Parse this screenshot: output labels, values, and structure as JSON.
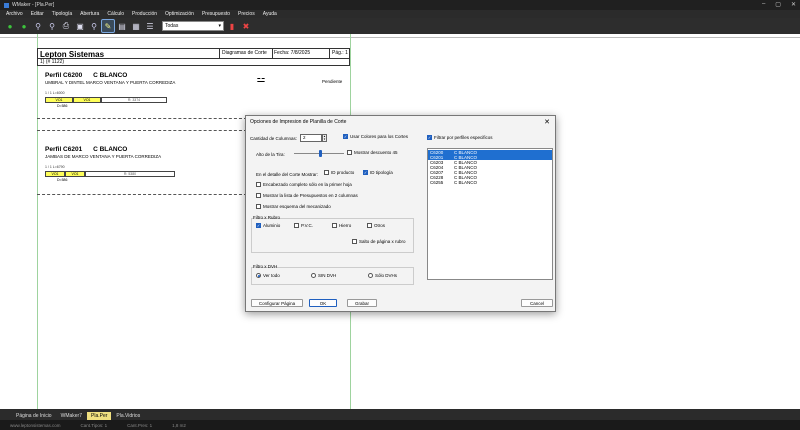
{
  "window": {
    "title": "WMaker - [Pla.Per]"
  },
  "menu": [
    "Archivo",
    "Editar",
    "Tipología",
    "Abertura",
    "Cálculo",
    "Producción",
    "Optimización",
    "Presupuesto",
    "Precios",
    "Ayuda"
  ],
  "toolbar": {
    "combo_value": "Todas"
  },
  "report": {
    "company": "Lepton Sistemas",
    "title": "Diagramas de Corte",
    "fecha": "Fecha: 7/8/2025",
    "pag": "Pág.: 1",
    "row2": "1)   (# 1122)",
    "profiles": [
      {
        "code": "Perfil C6200",
        "color": "C BLANCO",
        "desc": "UMBRAL Y DINTEL MARCO VENTANA Y PUERTA CORREDIZA",
        "status": "Pendiente",
        "small": "1 / 1   L=6000",
        "bars": [
          "VO1",
          "VO1",
          "R: 3374"
        ],
        "dim": "D=586"
      },
      {
        "code": "Perfil C6201",
        "color": "C BLANCO",
        "desc": "JAMBAS DE MARCO VENTANA Y PUERTA CORREDIZA",
        "small": "1 / 1   L=6790",
        "bars": [
          "VO1",
          "VO1",
          "R: 5380"
        ],
        "dim": "D=586"
      }
    ]
  },
  "dialog": {
    "title": "Opciones de Impresion de Planilla de Corte",
    "columnas_label": "Cantidad de Columnas:",
    "columnas_value": "2",
    "usar_colores": "Usar Colores para los Cortes",
    "alto_tira": "Alto de la Tira:",
    "mostrar_descuento": "Mostrar descuento 45",
    "detalle_label": "En el detalle del Corte Mostrar:",
    "id_producto": "ID producto",
    "id_tipologia": "ID tipología",
    "encabezado": "Encabezado completo sólo en la primer hoja",
    "mostrar_lista": "Mostrar la lista de Presupuestos en 2 columnas",
    "mostrar_esquema": "Mostrar esquema del mecanizado",
    "filtro_rubro": "Filtro x Rubro",
    "aluminio": "Aluminio",
    "pvc": "P.V.C.",
    "hierro": "Hierro",
    "otros": "Otros",
    "salto": "Salto de página x rubro",
    "filtro_dvh": "Filtro x DVH",
    "ver_todo": "Ver todo",
    "sin_dvh": "SIN DVH",
    "solo_dvh": "Sólo DVHs",
    "filtrar_perfiles": "Filtrar por perfiles especificos",
    "perfiles": [
      {
        "code": "C6200",
        "color": "C BLANCO",
        "selected": true
      },
      {
        "code": "C6201",
        "color": "C BLANCO",
        "selected": true
      },
      {
        "code": "C6203",
        "color": "C BLANCO",
        "selected": false
      },
      {
        "code": "C6204",
        "color": "C BLANCO",
        "selected": false
      },
      {
        "code": "C6207",
        "color": "C BLANCO",
        "selected": false
      },
      {
        "code": "C6228",
        "color": "C BLANCO",
        "selected": false
      },
      {
        "code": "C6255",
        "color": "C BLANCO",
        "selected": false
      }
    ],
    "btn_configurar": "Configurar Página",
    "btn_ok": "OK",
    "btn_grabar": "Grabar",
    "btn_cancel": "Cancel"
  },
  "tabs": [
    {
      "label": "Página de Inicio",
      "active": false
    },
    {
      "label": "WMaker7",
      "active": false
    },
    {
      "label": "Pla.Per",
      "active": true
    },
    {
      "label": "Pla.Vidrios",
      "active": false
    }
  ],
  "status": [
    "www.leptonsistemas.com",
    "Cant.Tipos: 1",
    "Cant.Pres: 1",
    "1,8 m2"
  ]
}
